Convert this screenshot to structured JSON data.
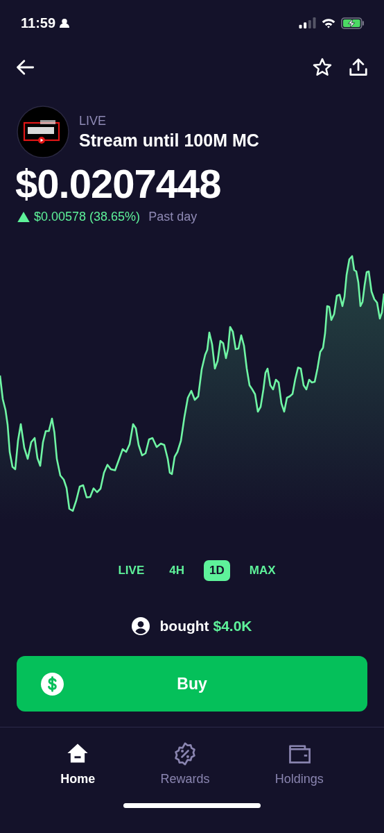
{
  "status_bar": {
    "time": "11:59"
  },
  "token": {
    "status": "LIVE",
    "name": "Stream until 100M MC"
  },
  "price": "$0.0207448",
  "change": {
    "rising": true,
    "amount": "$0.00578 (38.65%)",
    "period": "Past day"
  },
  "ranges": [
    {
      "label": "LIVE",
      "selected": false
    },
    {
      "label": "4H",
      "selected": false
    },
    {
      "label": "1D",
      "selected": true
    },
    {
      "label": "MAX",
      "selected": false
    }
  ],
  "activity": {
    "verb": "bought",
    "amount": "$4.0K"
  },
  "buy_button": "Buy",
  "nav": [
    {
      "kind": "home",
      "label": "Home",
      "selected": true
    },
    {
      "kind": "rewards",
      "label": "Rewards",
      "selected": false
    },
    {
      "kind": "holdings",
      "label": "Holdings",
      "selected": false
    }
  ]
}
